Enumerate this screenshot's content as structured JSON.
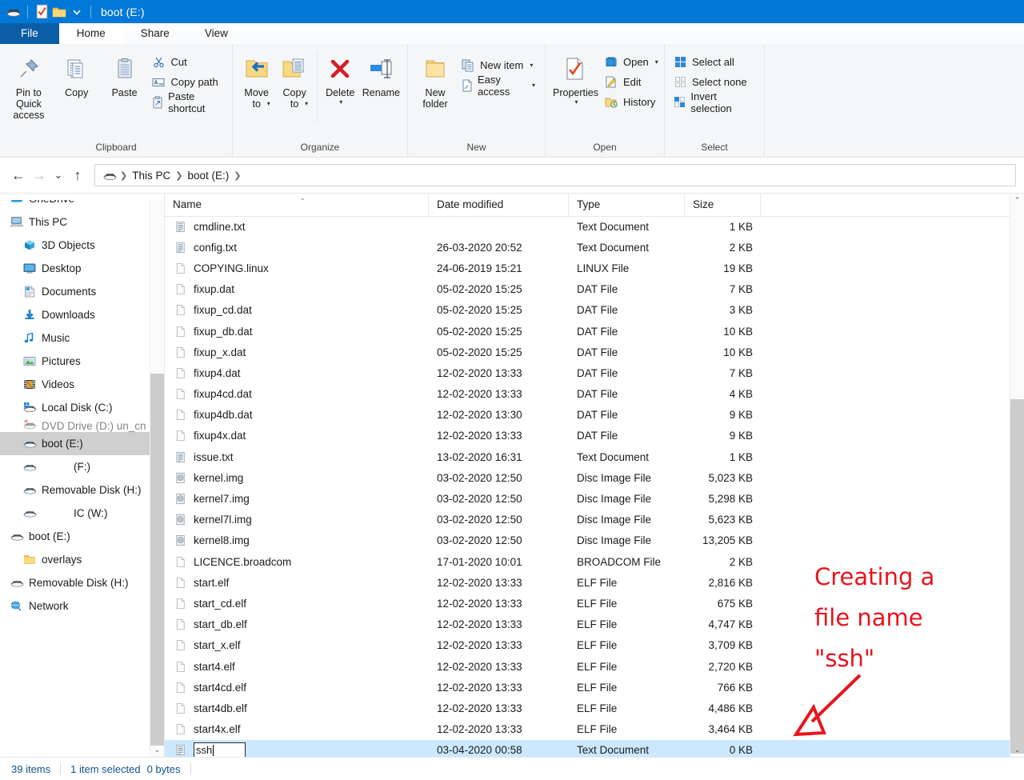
{
  "window": {
    "title": "boot (E:)",
    "quick_access": [
      "drive-icon",
      "properties-icon",
      "new-folder-icon",
      "customize-dropdown-icon"
    ]
  },
  "tabs": [
    {
      "label": "File",
      "state": "file"
    },
    {
      "label": "Home",
      "state": "active"
    },
    {
      "label": "Share",
      "state": "inactive"
    },
    {
      "label": "View",
      "state": "inactive"
    }
  ],
  "ribbon": {
    "groups": [
      {
        "title": "Clipboard",
        "big": [
          {
            "label": "Pin to Quick\naccess",
            "icon": "pin-icon"
          },
          {
            "label": "Copy",
            "icon": "copy-icon"
          },
          {
            "label": "Paste",
            "icon": "paste-icon"
          }
        ],
        "small": [
          {
            "label": "Cut",
            "icon": "scissors-icon"
          },
          {
            "label": "Copy path",
            "icon": "copy-path-icon"
          },
          {
            "label": "Paste shortcut",
            "icon": "paste-shortcut-icon"
          }
        ]
      },
      {
        "title": "Organize",
        "big": [
          {
            "label": "Move\nto",
            "icon": "move-to-icon",
            "dropdown": true
          },
          {
            "label": "Copy\nto",
            "icon": "copy-to-icon",
            "dropdown": true
          },
          {
            "label": "Delete",
            "icon": "delete-icon",
            "dropdown": true
          },
          {
            "label": "Rename",
            "icon": "rename-icon"
          }
        ],
        "small": []
      },
      {
        "title": "New",
        "big": [
          {
            "label": "New\nfolder",
            "icon": "new-folder-icon"
          }
        ],
        "small": [
          {
            "label": "New item",
            "icon": "new-item-icon",
            "dropdown": true
          },
          {
            "label": "Easy access",
            "icon": "easy-access-icon",
            "dropdown": true
          }
        ]
      },
      {
        "title": "Open",
        "big": [
          {
            "label": "Properties",
            "icon": "properties-icon",
            "dropdown": true
          }
        ],
        "small": [
          {
            "label": "Open",
            "icon": "open-icon",
            "dropdown": true
          },
          {
            "label": "Edit",
            "icon": "edit-icon"
          },
          {
            "label": "History",
            "icon": "history-icon"
          }
        ]
      },
      {
        "title": "Select",
        "big": [],
        "small": [
          {
            "label": "Select all",
            "icon": "select-all-icon"
          },
          {
            "label": "Select none",
            "icon": "select-none-icon"
          },
          {
            "label": "Invert selection",
            "icon": "invert-selection-icon"
          }
        ]
      }
    ]
  },
  "address": {
    "back": "back-arrow-icon",
    "forward": "forward-arrow-icon",
    "recent": "recent-locations-icon",
    "up": "up-arrow-icon",
    "drive_icon": "drive-icon",
    "crumbs": [
      "This PC",
      "boot (E:)"
    ]
  },
  "sidebar": {
    "items": [
      {
        "label": "OneDrive",
        "icon": "onedrive-icon",
        "level": 0,
        "selected": false
      },
      {
        "label": "This PC",
        "icon": "this-pc-icon",
        "level": 0,
        "selected": false
      },
      {
        "label": "3D Objects",
        "icon": "3d-objects-icon",
        "level": 1,
        "selected": false
      },
      {
        "label": "Desktop",
        "icon": "desktop-icon",
        "level": 1,
        "selected": false
      },
      {
        "label": "Documents",
        "icon": "documents-icon",
        "level": 1,
        "selected": false
      },
      {
        "label": "Downloads",
        "icon": "downloads-icon",
        "level": 1,
        "selected": false
      },
      {
        "label": "Music",
        "icon": "music-icon",
        "level": 1,
        "selected": false
      },
      {
        "label": "Pictures",
        "icon": "pictures-icon",
        "level": 1,
        "selected": false
      },
      {
        "label": "Videos",
        "icon": "videos-icon",
        "level": 1,
        "selected": false
      },
      {
        "label": "Local Disk (C:)",
        "icon": "local-disk-icon",
        "level": 1,
        "selected": false
      },
      {
        "label": "DVD Drive (D:) un_cn",
        "icon": "dvd-drive-icon",
        "level": 1,
        "selected": false,
        "clipped": true
      },
      {
        "label": "boot (E:)",
        "icon": "drive-icon",
        "level": 1,
        "selected": true
      },
      {
        "label": "(F:)",
        "icon": "drive-icon",
        "level": 1,
        "selected": false,
        "indent_label": true
      },
      {
        "label": "Removable Disk (H:)",
        "icon": "drive-icon",
        "level": 1,
        "selected": false
      },
      {
        "label": "IC (W:)",
        "icon": "drive-icon",
        "level": 1,
        "selected": false,
        "indent_label": true
      },
      {
        "label": "boot (E:)",
        "icon": "drive-icon",
        "level": 0,
        "selected": false
      },
      {
        "label": "overlays",
        "icon": "folder-icon",
        "level": 1,
        "selected": false
      },
      {
        "label": "Removable Disk (H:)",
        "icon": "drive-icon",
        "level": 0,
        "selected": false
      },
      {
        "label": "Network",
        "icon": "network-icon",
        "level": 0,
        "selected": false
      }
    ]
  },
  "filelist": {
    "columns": [
      "Name",
      "Date modified",
      "Type",
      "Size"
    ],
    "sort_column": "Name",
    "sort_direction": "ascending",
    "rows": [
      {
        "name": "cmdline.txt",
        "date": "",
        "type": "Text Document",
        "size": "1 KB",
        "icon": "text-file-icon"
      },
      {
        "name": "config.txt",
        "date": "26-03-2020 20:52",
        "type": "Text Document",
        "size": "2 KB",
        "icon": "text-file-icon"
      },
      {
        "name": "COPYING.linux",
        "date": "24-06-2019 15:21",
        "type": "LINUX File",
        "size": "19 KB",
        "icon": "generic-file-icon"
      },
      {
        "name": "fixup.dat",
        "date": "05-02-2020 15:25",
        "type": "DAT File",
        "size": "7 KB",
        "icon": "generic-file-icon"
      },
      {
        "name": "fixup_cd.dat",
        "date": "05-02-2020 15:25",
        "type": "DAT File",
        "size": "3 KB",
        "icon": "generic-file-icon"
      },
      {
        "name": "fixup_db.dat",
        "date": "05-02-2020 15:25",
        "type": "DAT File",
        "size": "10 KB",
        "icon": "generic-file-icon"
      },
      {
        "name": "fixup_x.dat",
        "date": "05-02-2020 15:25",
        "type": "DAT File",
        "size": "10 KB",
        "icon": "generic-file-icon"
      },
      {
        "name": "fixup4.dat",
        "date": "12-02-2020 13:33",
        "type": "DAT File",
        "size": "7 KB",
        "icon": "generic-file-icon"
      },
      {
        "name": "fixup4cd.dat",
        "date": "12-02-2020 13:33",
        "type": "DAT File",
        "size": "4 KB",
        "icon": "generic-file-icon"
      },
      {
        "name": "fixup4db.dat",
        "date": "12-02-2020 13:30",
        "type": "DAT File",
        "size": "9 KB",
        "icon": "generic-file-icon"
      },
      {
        "name": "fixup4x.dat",
        "date": "12-02-2020 13:33",
        "type": "DAT File",
        "size": "9 KB",
        "icon": "generic-file-icon"
      },
      {
        "name": "issue.txt",
        "date": "13-02-2020 16:31",
        "type": "Text Document",
        "size": "1 KB",
        "icon": "text-file-icon"
      },
      {
        "name": "kernel.img",
        "date": "03-02-2020 12:50",
        "type": "Disc Image File",
        "size": "5,023 KB",
        "icon": "disc-image-icon"
      },
      {
        "name": "kernel7.img",
        "date": "03-02-2020 12:50",
        "type": "Disc Image File",
        "size": "5,298 KB",
        "icon": "disc-image-icon"
      },
      {
        "name": "kernel7l.img",
        "date": "03-02-2020 12:50",
        "type": "Disc Image File",
        "size": "5,623 KB",
        "icon": "disc-image-icon"
      },
      {
        "name": "kernel8.img",
        "date": "03-02-2020 12:50",
        "type": "Disc Image File",
        "size": "13,205 KB",
        "icon": "disc-image-icon"
      },
      {
        "name": "LICENCE.broadcom",
        "date": "17-01-2020 10:01",
        "type": "BROADCOM File",
        "size": "2 KB",
        "icon": "generic-file-icon"
      },
      {
        "name": "start.elf",
        "date": "12-02-2020 13:33",
        "type": "ELF File",
        "size": "2,816 KB",
        "icon": "generic-file-icon"
      },
      {
        "name": "start_cd.elf",
        "date": "12-02-2020 13:33",
        "type": "ELF File",
        "size": "675 KB",
        "icon": "generic-file-icon"
      },
      {
        "name": "start_db.elf",
        "date": "12-02-2020 13:33",
        "type": "ELF File",
        "size": "4,747 KB",
        "icon": "generic-file-icon"
      },
      {
        "name": "start_x.elf",
        "date": "12-02-2020 13:33",
        "type": "ELF File",
        "size": "3,709 KB",
        "icon": "generic-file-icon"
      },
      {
        "name": "start4.elf",
        "date": "12-02-2020 13:33",
        "type": "ELF File",
        "size": "2,720 KB",
        "icon": "generic-file-icon"
      },
      {
        "name": "start4cd.elf",
        "date": "12-02-2020 13:33",
        "type": "ELF File",
        "size": "766 KB",
        "icon": "generic-file-icon"
      },
      {
        "name": "start4db.elf",
        "date": "12-02-2020 13:33",
        "type": "ELF File",
        "size": "4,486 KB",
        "icon": "generic-file-icon"
      },
      {
        "name": "start4x.elf",
        "date": "12-02-2020 13:33",
        "type": "ELF File",
        "size": "3,464 KB",
        "icon": "generic-file-icon"
      }
    ],
    "rename_row": {
      "value": "ssh",
      "date": "03-04-2020 00:58",
      "type": "Text Document",
      "size": "0 KB",
      "icon": "text-file-icon"
    }
  },
  "statusbar": {
    "item_count": "39 items",
    "selection": "1 item selected",
    "selection_size": "0 bytes"
  },
  "annotation": {
    "text": "Creating a\nfile name\n\"ssh\"",
    "color": "#e8141c"
  },
  "colors": {
    "accent": "#0078d7",
    "title_bar": "#0078d7",
    "file_tab": "#0b5da5",
    "selection": "#cce8ff",
    "nav_selection": "#cfcfcf",
    "ribbon_bg": "#f4f6f8",
    "status_text": "#12508f",
    "annotation_red": "#e8141c"
  }
}
